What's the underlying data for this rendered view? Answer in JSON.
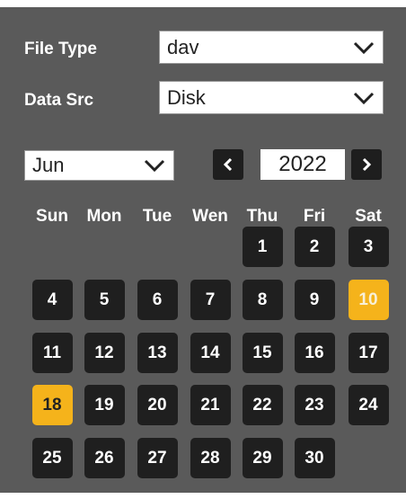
{
  "file_type": {
    "label": "File Type",
    "value": "dav"
  },
  "data_src": {
    "label": "Data Src",
    "value": "Disk"
  },
  "month_select": {
    "value": "Jun"
  },
  "year_nav": {
    "prev_icon": "chevron-left-icon",
    "year": "2022",
    "next_icon": "chevron-right-icon"
  },
  "weekdays": [
    "Sun",
    "Mon",
    "Tue",
    "Wen",
    "Thu",
    "Fri",
    "Sat"
  ],
  "calendar": {
    "first_weekday_index": 4,
    "days": [
      "1",
      "2",
      "3",
      "4",
      "5",
      "6",
      "7",
      "8",
      "9",
      "10",
      "11",
      "12",
      "13",
      "14",
      "15",
      "16",
      "17",
      "18",
      "19",
      "20",
      "21",
      "22",
      "23",
      "24",
      "25",
      "26",
      "27",
      "28",
      "29",
      "30"
    ],
    "today": "10",
    "selected": "18"
  },
  "colors": {
    "panel_bg": "#5a5a5a",
    "day_bg": "#1f1f1f",
    "highlight": "#f5b31b"
  }
}
